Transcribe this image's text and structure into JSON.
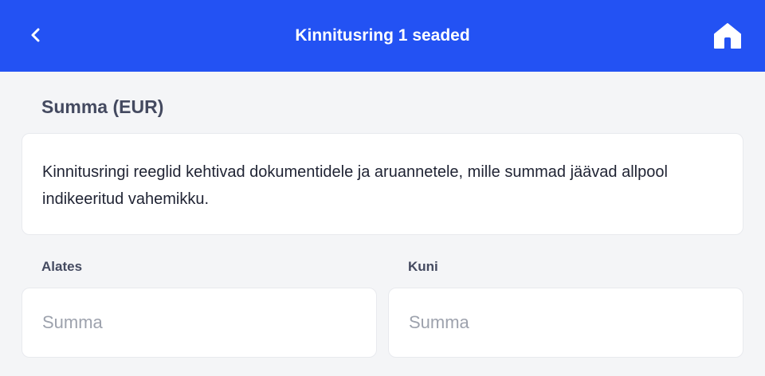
{
  "header": {
    "title": "Kinnitusring 1 seaded",
    "back_icon": "chevron-left-icon",
    "home_icon": "home-icon",
    "background_color": "#2352f3"
  },
  "section": {
    "title": "Summa (EUR)"
  },
  "info": {
    "text": "Kinnitusringi reeglid kehtivad dokumentidele ja aruannetele, mille summad jäävad allpool indikeeritud vahemikku."
  },
  "range": {
    "from": {
      "label": "Alates",
      "value": "",
      "placeholder": "Summa"
    },
    "to": {
      "label": "Kuni",
      "value": "",
      "placeholder": "Summa"
    }
  }
}
